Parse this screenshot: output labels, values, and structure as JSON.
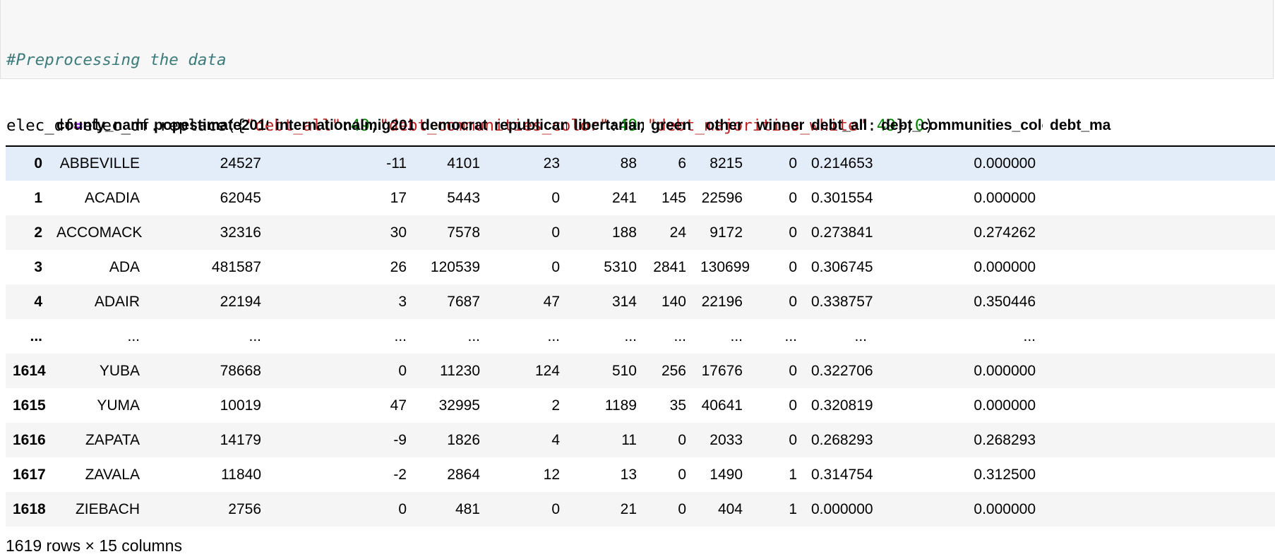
{
  "code": {
    "comment": "#Preprocessing the data",
    "line2": {
      "lhs": "elec_df",
      "op": "=",
      "call_prefix": "elec_df.replace({",
      "k1": "\"debt_all\"",
      "colon1": ":",
      "v1": "49",
      "sep1": ",",
      "k2": "\"debt_communities_color\"",
      "colon2": ":",
      "v2": "49",
      "sep2": ",",
      "k3": "\"debt_majorities_white\"",
      "colon3": ":",
      "v3": "49",
      "close1": "},",
      "arg2": "0",
      "close2": ")"
    },
    "line3": "elec_df"
  },
  "table": {
    "columns": [
      "",
      "county_name",
      "popestimate2019",
      "internationalmig2019",
      "democrat",
      "republican",
      "libertarian",
      "green",
      "other",
      "winner",
      "debt_all",
      "debt_communities_color",
      "debt_ma"
    ],
    "rows": [
      {
        "index": "0",
        "cells": [
          "ABBEVILLE",
          "24527",
          "-11",
          "4101",
          "23",
          "88",
          "6",
          "8215",
          "0",
          "0.214653",
          "0.000000",
          ""
        ],
        "highlighted": true
      },
      {
        "index": "1",
        "cells": [
          "ACADIA",
          "62045",
          "17",
          "5443",
          "0",
          "241",
          "145",
          "22596",
          "0",
          "0.301554",
          "0.000000",
          ""
        ]
      },
      {
        "index": "2",
        "cells": [
          "ACCOMACK",
          "32316",
          "30",
          "7578",
          "0",
          "188",
          "24",
          "9172",
          "0",
          "0.273841",
          "0.274262",
          ""
        ]
      },
      {
        "index": "3",
        "cells": [
          "ADA",
          "481587",
          "26",
          "120539",
          "0",
          "5310",
          "2841",
          "130699",
          "0",
          "0.306745",
          "0.000000",
          ""
        ]
      },
      {
        "index": "4",
        "cells": [
          "ADAIR",
          "22194",
          "3",
          "7687",
          "47",
          "314",
          "140",
          "22196",
          "0",
          "0.338757",
          "0.350446",
          ""
        ]
      },
      {
        "index": "...",
        "cells": [
          "...",
          "...",
          "...",
          "...",
          "...",
          "...",
          "...",
          "...",
          "...",
          "...",
          "...",
          ""
        ],
        "ellipsis": true
      },
      {
        "index": "1614",
        "cells": [
          "YUBA",
          "78668",
          "0",
          "11230",
          "124",
          "510",
          "256",
          "17676",
          "0",
          "0.322706",
          "0.000000",
          ""
        ]
      },
      {
        "index": "1615",
        "cells": [
          "YUMA",
          "10019",
          "47",
          "32995",
          "2",
          "1189",
          "35",
          "40641",
          "0",
          "0.320819",
          "0.000000",
          ""
        ]
      },
      {
        "index": "1616",
        "cells": [
          "ZAPATA",
          "14179",
          "-9",
          "1826",
          "4",
          "11",
          "0",
          "2033",
          "0",
          "0.268293",
          "0.268293",
          ""
        ]
      },
      {
        "index": "1617",
        "cells": [
          "ZAVALA",
          "11840",
          "-2",
          "2864",
          "12",
          "13",
          "0",
          "1490",
          "1",
          "0.314754",
          "0.312500",
          ""
        ]
      },
      {
        "index": "1618",
        "cells": [
          "ZIEBACH",
          "2756",
          "0",
          "481",
          "0",
          "21",
          "0",
          "404",
          "1",
          "0.000000",
          "0.000000",
          ""
        ]
      }
    ]
  },
  "shape_info": "1619 rows × 15 columns",
  "colors": {
    "comment": "#3d7b7b",
    "operator": "#aa22ff",
    "string": "#ba2121",
    "number": "#008000",
    "highlight_row": "#e3edfa",
    "stripe_row": "#f5f5f5"
  }
}
